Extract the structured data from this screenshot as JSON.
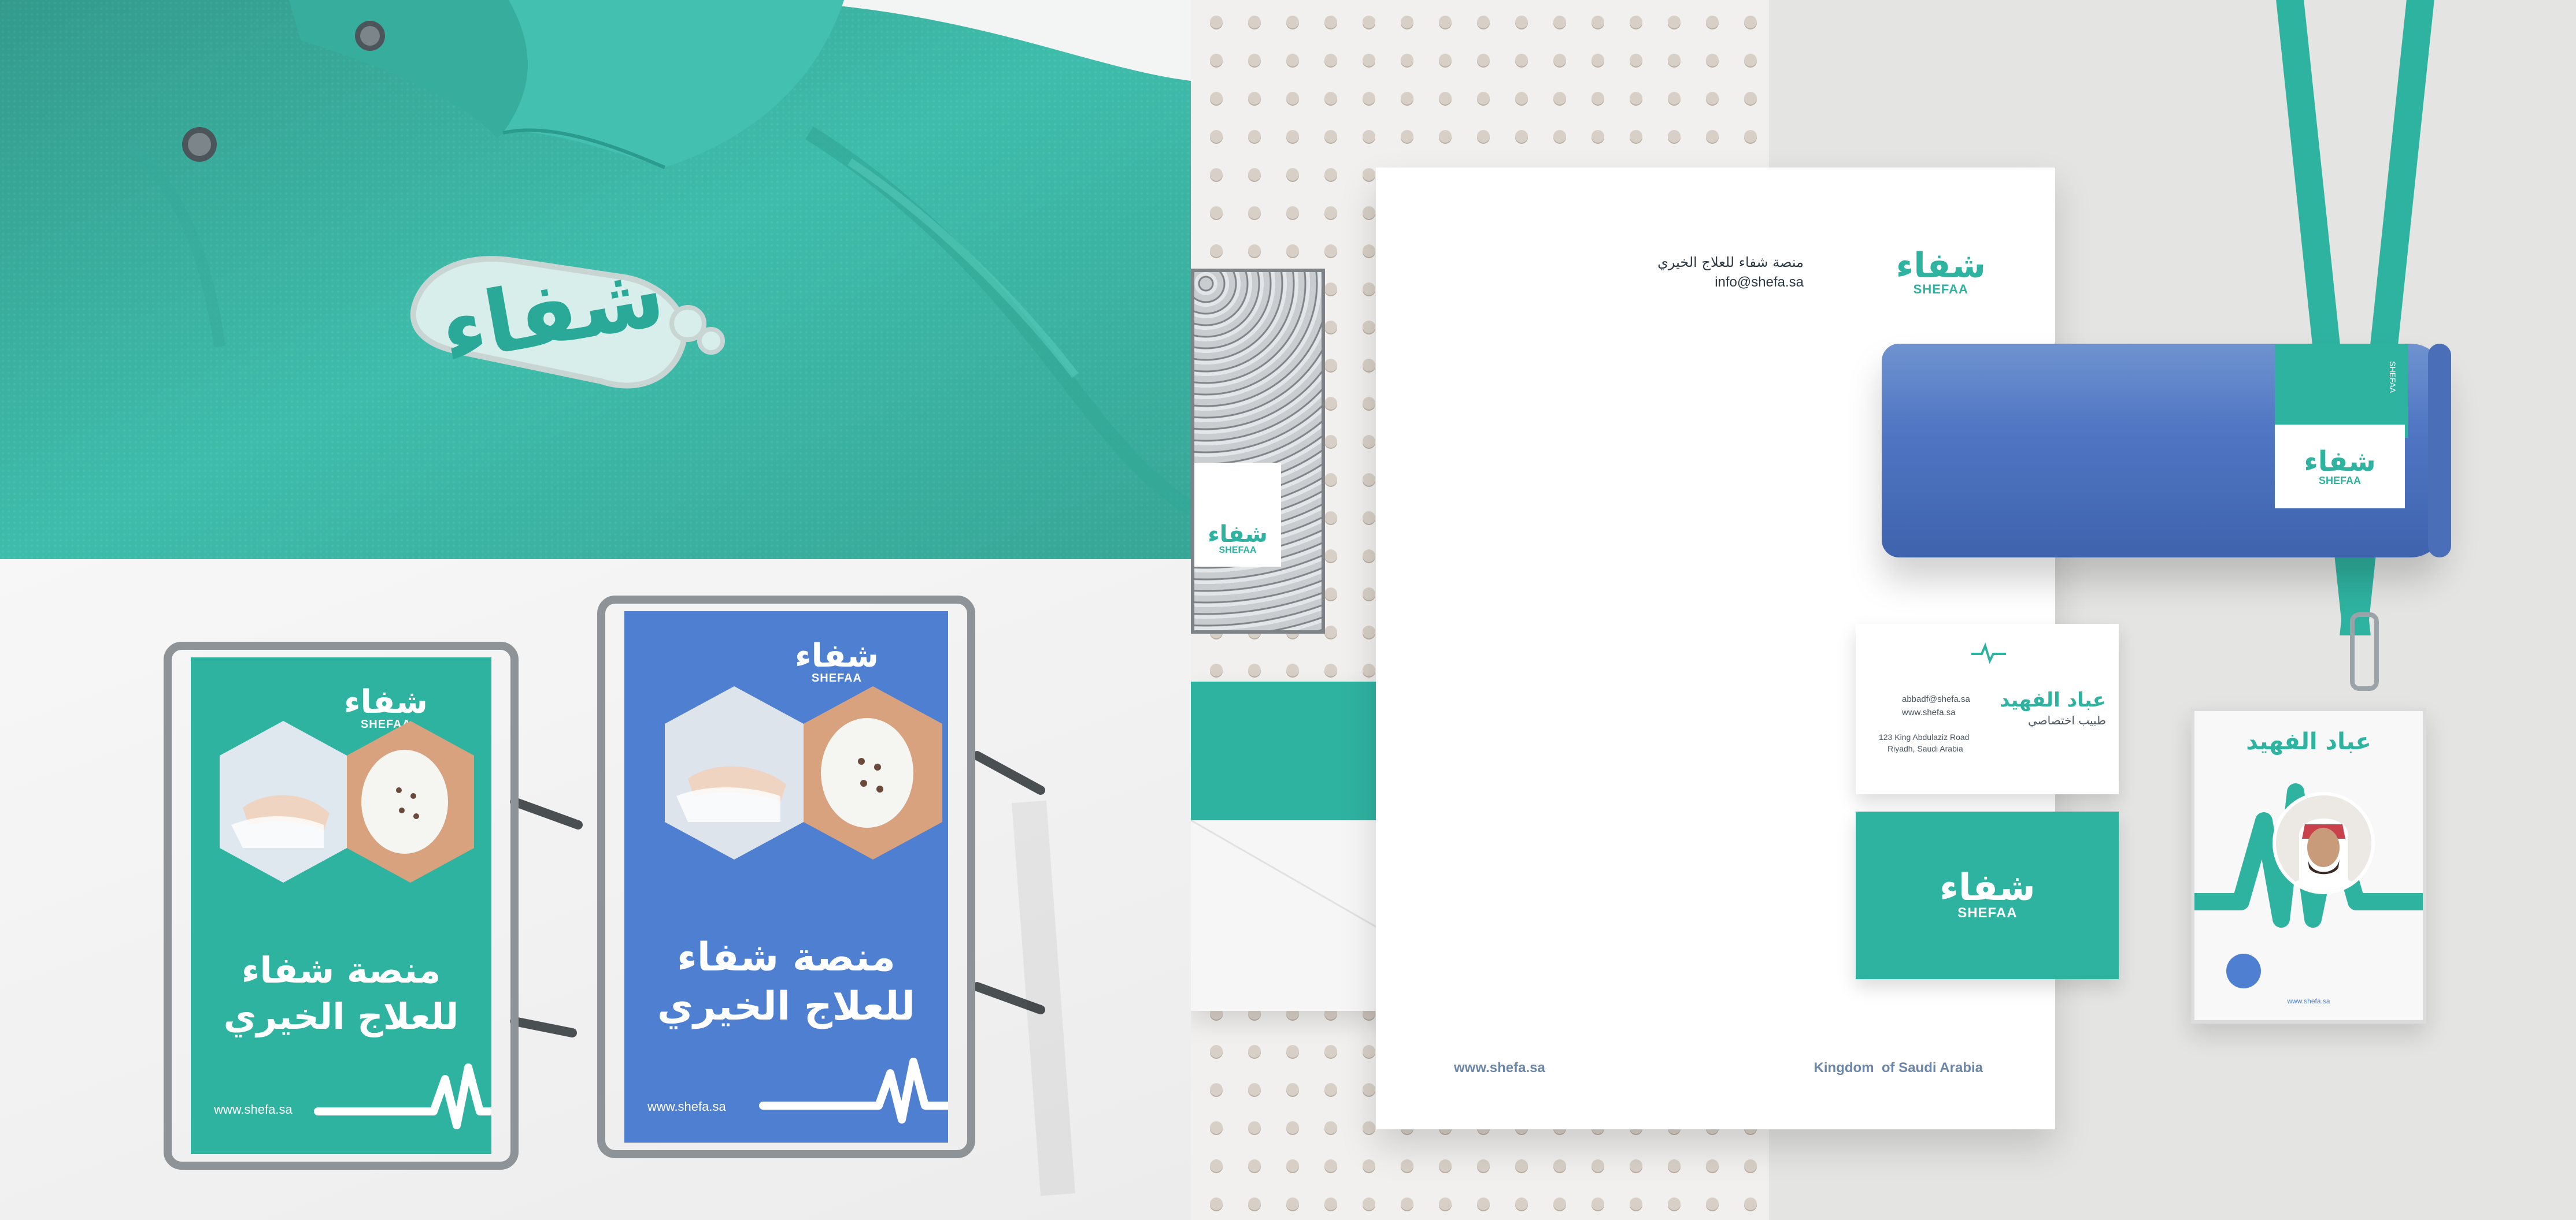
{
  "brand": {
    "name_ar": "شفاء",
    "name_en": "SHEFAA",
    "registered": "®",
    "teal": "#2fb3a1",
    "blue": "#4f7fd1",
    "slate": "#6b86a8"
  },
  "polo": {
    "pin_logo_ar": "شفاء"
  },
  "posters": {
    "headline_line1": "منصة شفاء",
    "headline_line2": "للعلاج الخيري",
    "website": "www.shefa.sa"
  },
  "letterhead": {
    "org_name": "منصة شفاء للعلاج الخيري",
    "email": "info@shefa.sa",
    "website": "www.shefa.sa",
    "country": "Kingdom  of Saudi Arabia"
  },
  "business_card": {
    "name": "عباد الفهيد",
    "title": "طبيب اختصاصي",
    "email": "abbadf@shefa.sa",
    "web": "www.shefa.sa",
    "address_line1": "123 King Abdulaziz Road",
    "address_line2": "Riyadh, Saudi Arabia"
  },
  "id_badge": {
    "name": "عباد الفهيد",
    "website": "www.shefa.sa"
  },
  "tube_label": {
    "side_text": "SHEFAA"
  }
}
